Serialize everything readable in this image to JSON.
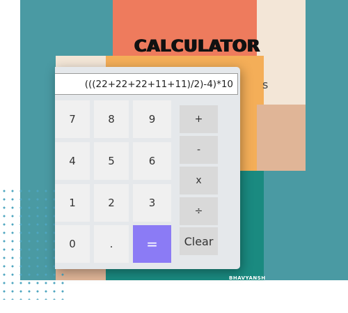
{
  "colors": {
    "teal": "#4a9aa3",
    "coral": "#ee7b5d",
    "cream": "#f3e6d7",
    "orange": "#f4ae58",
    "peach": "#e0b597",
    "dark_teal": "#1a8a80",
    "equals_accent": "#8b7bf5",
    "number_key": "#f0f0f0",
    "operator_key": "#d9d9d9",
    "dots": "#4fa6c0"
  },
  "header": {
    "title": "CALCULATOR",
    "hidden_fragment": "s"
  },
  "calculator": {
    "display_value": "(((22+22+22+11+11)/2)-4)*10",
    "keys": [
      {
        "label": "7"
      },
      {
        "label": "8"
      },
      {
        "label": "9"
      },
      {
        "label": "4"
      },
      {
        "label": "5"
      },
      {
        "label": "6"
      },
      {
        "label": "1"
      },
      {
        "label": "2"
      },
      {
        "label": "3"
      },
      {
        "label": "0"
      },
      {
        "label": "."
      },
      {
        "label": "="
      }
    ],
    "operators": [
      {
        "label": "+"
      },
      {
        "label": "-"
      },
      {
        "label": "x"
      },
      {
        "label": "÷"
      },
      {
        "label": "Clear"
      }
    ]
  },
  "watermark": "BHAVYANSH"
}
